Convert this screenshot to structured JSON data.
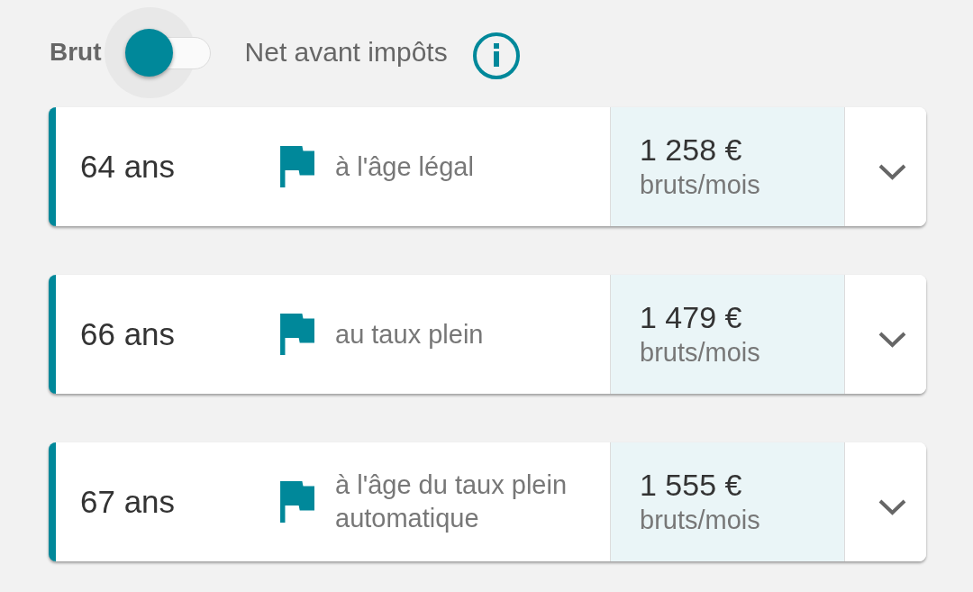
{
  "toggle": {
    "left_label": "Brut",
    "right_label": "Net avant impôts",
    "checked": false
  },
  "options": [
    {
      "age": "64 ans",
      "description": "à l'âge légal",
      "amount": "1 258 €",
      "unit": "bruts/mois",
      "expanded": false
    },
    {
      "age": "66 ans",
      "description": "au taux plein",
      "amount": "1 479 €",
      "unit": "bruts/mois",
      "expanded": false
    },
    {
      "age": "67 ans",
      "description": "à l'âge du taux plein automatique",
      "amount": "1 555 €",
      "unit": "bruts/mois",
      "expanded": false
    }
  ]
}
